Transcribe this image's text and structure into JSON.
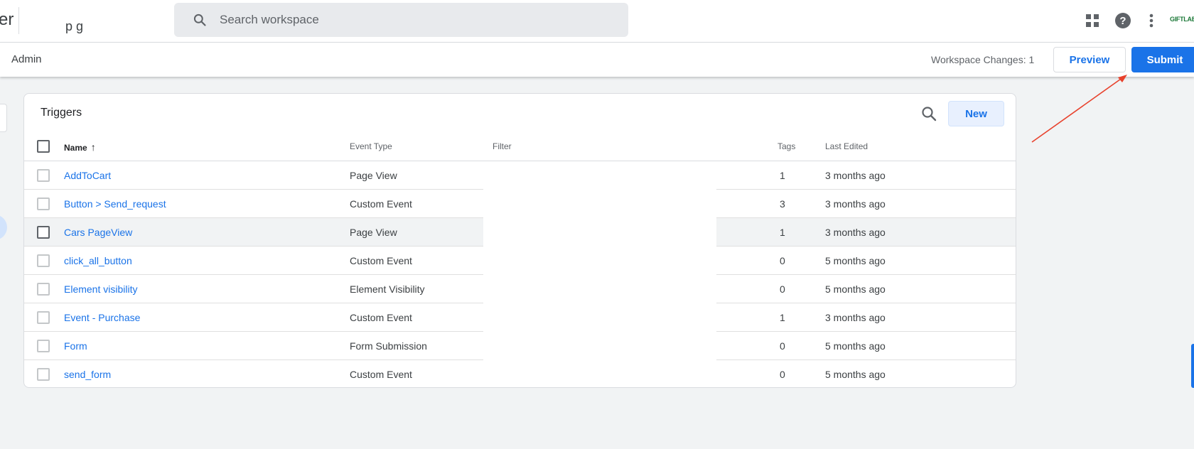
{
  "header": {
    "app_name_fragment": "er",
    "container_fragment": "p g",
    "search_placeholder": "Search workspace",
    "brand_logo_text": "GIFTLAB",
    "icons": [
      "apps-grid-icon",
      "help-icon",
      "more-vert-icon"
    ]
  },
  "subbar": {
    "admin_label": "Admin",
    "workspace_changes": "Workspace Changes: 1",
    "preview_label": "Preview",
    "submit_label": "Submit"
  },
  "triggers": {
    "title": "Triggers",
    "new_label": "New",
    "columns": {
      "name": "Name",
      "event_type": "Event Type",
      "filter": "Filter",
      "tags": "Tags",
      "last_edited": "Last Edited"
    },
    "rows": [
      {
        "name": "AddToCart",
        "event_type": "Page View",
        "filter": "",
        "tags": "1",
        "last_edited": "3 months ago"
      },
      {
        "name": "Button > Send_request",
        "event_type": "Custom Event",
        "filter": "",
        "tags": "3",
        "last_edited": "3 months ago"
      },
      {
        "name": "Cars PageView",
        "event_type": "Page View",
        "filter": "",
        "tags": "1",
        "last_edited": "3 months ago"
      },
      {
        "name": "click_all_button",
        "event_type": "Custom Event",
        "filter": "",
        "tags": "0",
        "last_edited": "5 months ago"
      },
      {
        "name": "Element visibility",
        "event_type": "Element Visibility",
        "filter": "",
        "tags": "0",
        "last_edited": "5 months ago"
      },
      {
        "name": "Event - Purchase",
        "event_type": "Custom Event",
        "filter": "",
        "tags": "1",
        "last_edited": "3 months ago"
      },
      {
        "name": "Form",
        "event_type": "Form Submission",
        "filter": "",
        "tags": "0",
        "last_edited": "5 months ago"
      },
      {
        "name": "send_form",
        "event_type": "Custom Event",
        "filter": "",
        "tags": "0",
        "last_edited": "5 months ago"
      }
    ],
    "hovered_row": "Cars PageView",
    "sort": {
      "column": "Name",
      "direction": "ascending"
    }
  },
  "colors": {
    "accent": "#1a73e8",
    "annotation_arrow": "#e8412c",
    "background": "#f1f3f4"
  }
}
